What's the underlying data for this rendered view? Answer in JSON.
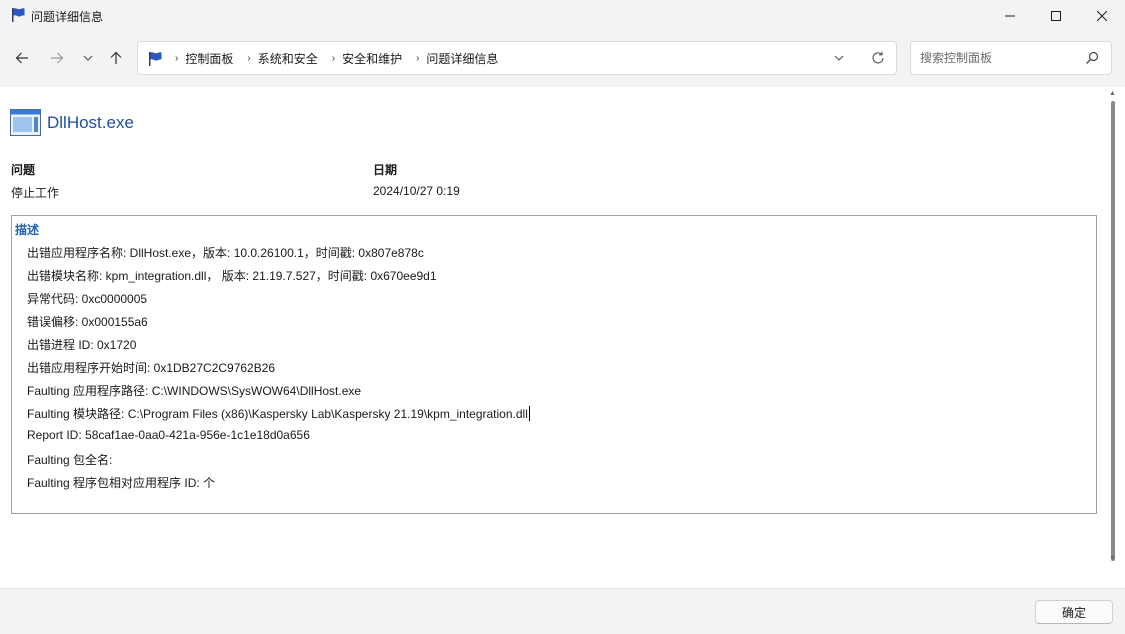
{
  "window": {
    "title": "问题详细信息",
    "controls": {
      "minimize_icon": "minimize-icon",
      "maximize_icon": "maximize-icon",
      "close_icon": "close-icon"
    }
  },
  "nav": {
    "buttons": [
      "back-arrow-icon",
      "forward-arrow-icon",
      "chevron-down-icon",
      "up-arrow-icon"
    ],
    "breadcrumbs": [
      "控制面板",
      "系统和安全",
      "安全和维护",
      "问题详细信息"
    ],
    "search_placeholder": "搜索控制面板"
  },
  "app": {
    "name": "DllHost.exe"
  },
  "summary": {
    "problem_label": "问题",
    "problem_value": "停止工作",
    "date_label": "日期",
    "date_value": "2024/10/27 0:19"
  },
  "description": {
    "title": "描述",
    "lines": [
      "出错应用程序名称:  DllHost.exe，版本:  10.0.26100.1，时间戳:  0x807e878c",
      "出错模块名称:  kpm_integration.dll，  版本:  21.19.7.527，时间戳:  0x670ee9d1",
      "异常代码:  0xc0000005",
      "错误偏移:  0x000155a6",
      "出错进程 ID:  0x1720",
      "出错应用程序开始时间:  0x1DB27C2C9762B26",
      "Faulting 应用程序路径:  C:\\WINDOWS\\SysWOW64\\DllHost.exe",
      "Faulting 模块路径:  C:\\Program Files (x86)\\Kaspersky Lab\\Kaspersky 21.19\\kpm_integration.dll",
      "Report ID:  58caf1ae-0aa0-421a-956e-1c1e18d0a656",
      "Faulting 包全名:",
      "Faulting 程序包相对应用程序 ID:  个"
    ]
  },
  "footer": {
    "ok_label": "确定"
  }
}
